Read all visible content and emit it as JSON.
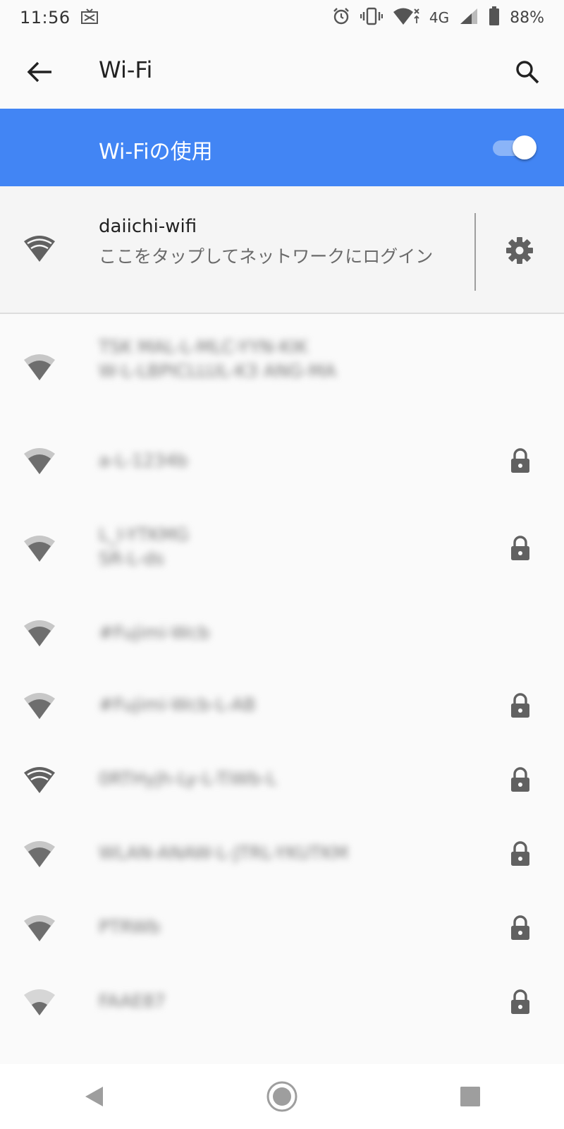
{
  "status_bar": {
    "time": "11:56",
    "network_type": "4G",
    "battery_percent": "88%",
    "icons": [
      "cast-icon",
      "alarm-icon",
      "vibrate-icon",
      "wifi-data-icon",
      "signal-icon",
      "battery-icon"
    ]
  },
  "appbar": {
    "title": "Wi-Fi",
    "back_icon": "arrow-left-icon",
    "search_icon": "search-icon"
  },
  "wifi_toggle": {
    "label": "Wi-Fiの使用",
    "state": "on"
  },
  "connected_network": {
    "name": "daiichi-wifi",
    "status": "ここをタップしてネットワークにログイン",
    "settings_icon": "gear-icon"
  },
  "networks": [
    {
      "name": "TSK MAL-L-MLC-YYN-KIK",
      "detail": "W-L-LBPICLLUL-K3 ANG-MA",
      "locked": false,
      "signal": "medium"
    },
    {
      "name": "a-L-1234b",
      "locked": true,
      "signal": "medium"
    },
    {
      "name": "L_I-YTKMG",
      "detail": "SR-L-ds",
      "locked": true,
      "signal": "medium"
    },
    {
      "name": "#Fujimi-Wcb",
      "locked": false,
      "signal": "medium"
    },
    {
      "name": "#Fujimi-Wcb-L-AB",
      "locked": true,
      "signal": "medium"
    },
    {
      "name": "0RTHyjh-Ly-L-TiWb-L",
      "locked": true,
      "signal": "strong"
    },
    {
      "name": "WLAN-ANAW-L-JTRL-YKUTKM",
      "locked": true,
      "signal": "medium"
    },
    {
      "name": "PTRWb",
      "locked": true,
      "signal": "medium"
    },
    {
      "name": "FAAE87",
      "locked": true,
      "signal": "weak"
    }
  ],
  "nav_bar": {
    "back_icon": "nav-back-icon",
    "home_icon": "nav-home-icon",
    "recents_icon": "nav-recents-icon"
  },
  "colors": {
    "accent": "#4285f4",
    "toggle_track": "#8ab4f8",
    "background": "#fafafa",
    "icon_dark": "#616161"
  }
}
